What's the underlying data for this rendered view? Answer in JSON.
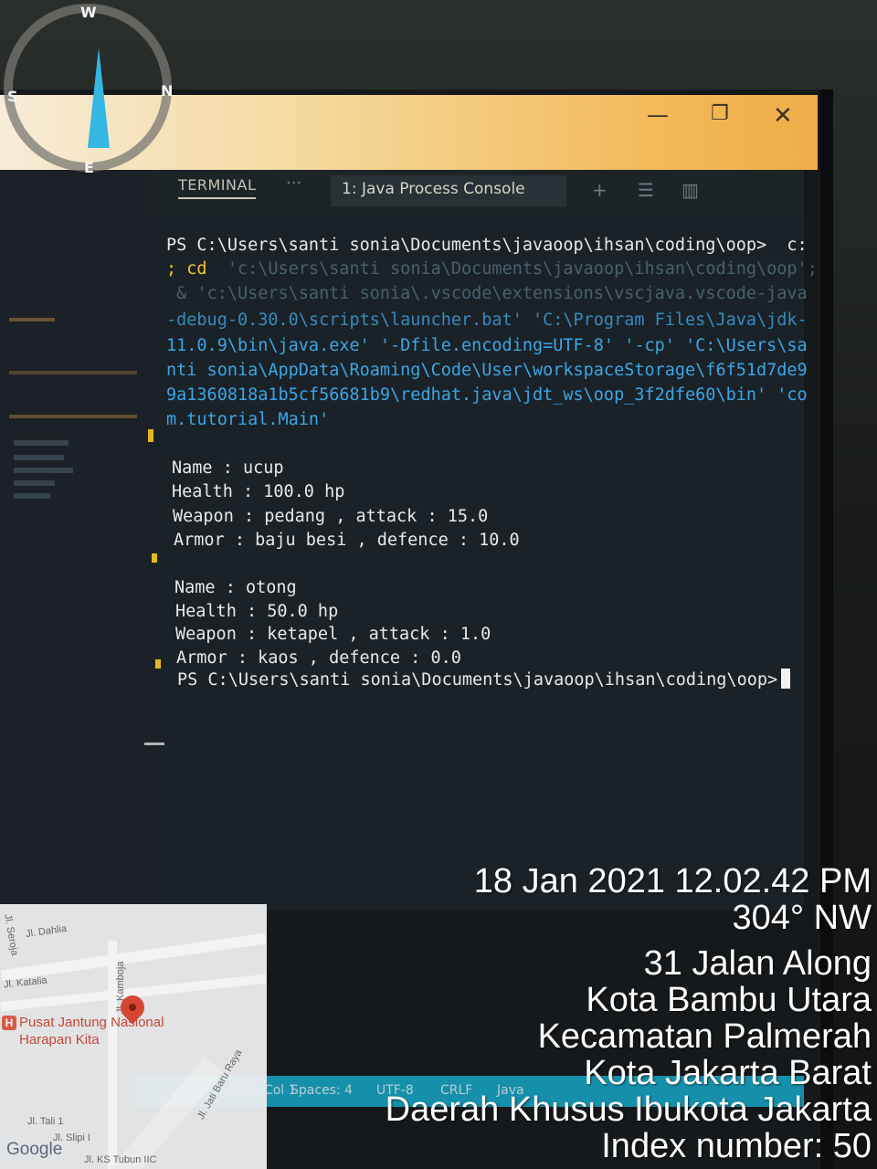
{
  "window": {
    "minimize_glyph": "—",
    "maximize_glyph": "❐",
    "close_glyph": "✕"
  },
  "panel": {
    "tab_label": "TERMINAL",
    "more_glyph": "···",
    "console_select_value": "1: Java Process Console"
  },
  "terminal": {
    "prompt_cmd_line1": "PS C:\\Users\\santi sonia\\Documents\\javaoop\\ihsan\\coding\\oop>  c:",
    "prompt_cmd_line2": "; cd",
    "prompt_cmd_line2_dim": "  'c:\\Users\\santi sonia\\Documents\\javaoop\\ihsan\\coding\\oop';",
    "prompt_cmd_line3": " & 'c:\\Users\\santi sonia\\.vscode\\extensions\\vscjava.vscode-java",
    "prompt_cmd_line4": "-debug-0.30.0\\scripts\\launcher.bat' 'C:\\Program Files\\Java\\jdk-",
    "prompt_cmd_line5": "11.0.9\\bin\\java.exe' '-Dfile.encoding=UTF-8' '-cp' 'C:\\Users\\sa",
    "prompt_cmd_line6": "nti sonia\\AppData\\Roaming\\Code\\User\\workspaceStorage\\f6f51d7de9",
    "prompt_cmd_line7": "9a1360818a1b5cf56681b9\\redhat.java\\jdt_ws\\oop_3f2dfe60\\bin' 'co",
    "prompt_cmd_line8": "m.tutorial.Main'",
    "player1": {
      "name": "Name : ucup",
      "health": "Health : 100.0 hp",
      "weapon": "Weapon : pedang , attack : 15.0",
      "armor": "Armor : baju besi , defence : 10.0"
    },
    "player2": {
      "name": "Name : otong",
      "health": "Health : 50.0 hp",
      "weapon": "Weapon : ketapel , attack : 1.0",
      "armor": "Armor : kaos , defence : 0.0"
    },
    "final_prompt": "PS C:\\Users\\santi sonia\\Documents\\javaoop\\ihsan\\coding\\oop>"
  },
  "statusbar": {
    "position": "Ln 9, Col 1",
    "spaces": "Spaces: 4",
    "encoding": "UTF-8",
    "eol": "CRLF",
    "language": "Java"
  },
  "compass": {
    "top": "W",
    "right": "N",
    "bottom": "E",
    "left": "S"
  },
  "map": {
    "labels": {
      "seroja": "Jl. Seroja",
      "dahlia": "Jl. Dahlia",
      "katalia": "Jl. Katalia",
      "kamboja": "Jl. Kamboja",
      "poi": "Pusat Jantung Nasional Harapan Kita",
      "jati_baru": "Jl. Jati Baru Raya",
      "tali": "Jl. Tali 1",
      "slipi": "Jl. Slipi I",
      "ks_tubun": "Jl. KS Tubun IIC"
    },
    "attribution": "Google"
  },
  "stamp": {
    "datetime": "18 Jan 2021 12.02.42 PM",
    "heading": "304° NW",
    "address1": "31 Jalan Along",
    "address2": "Kota Bambu Utara",
    "address3": "Kecamatan Palmerah",
    "address4": "Kota Jakarta Barat",
    "address5": "Daerah Khusus Ibukota Jakarta",
    "index": "Index number: 50"
  }
}
